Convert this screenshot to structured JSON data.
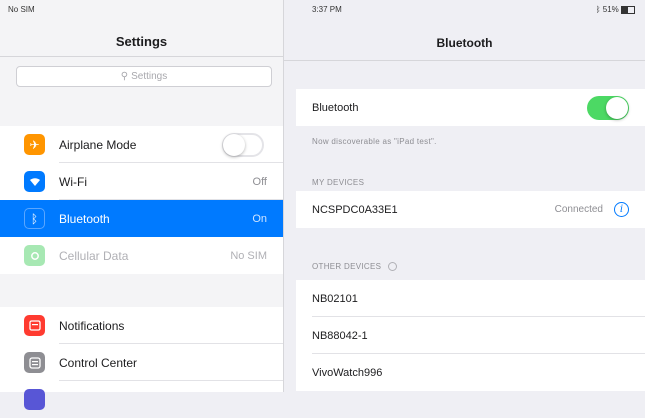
{
  "left": {
    "status_text": "No SIM",
    "title": "Settings",
    "search": {
      "placeholder": "Settings"
    },
    "items": [
      {
        "label": "Airplane Mode",
        "value": "",
        "toggle": "off",
        "icon": "airplane-icon",
        "color": "#ff9500"
      },
      {
        "label": "Wi-Fi",
        "value": "Off",
        "icon": "wifi-icon",
        "color": "#007aff"
      },
      {
        "label": "Bluetooth",
        "value": "On",
        "icon": "bluetooth-icon",
        "color": "#007aff",
        "selected": true
      },
      {
        "label": "Cellular Data",
        "value": "No SIM",
        "icon": "cellular-icon",
        "color": "#4cd964",
        "disabled": true
      },
      {
        "label": "Notifications",
        "icon": "notifications-icon",
        "color": "#ff3b30"
      },
      {
        "label": "Control Center",
        "icon": "control-center-icon",
        "color": "#8e8e93"
      }
    ]
  },
  "right": {
    "time": "3:37 PM",
    "battery": "51%",
    "title": "Bluetooth",
    "bluetooth_label": "Bluetooth",
    "bluetooth_on": true,
    "discoverable_note": "Now discoverable as \"iPad test\".",
    "my_devices_header": "MY DEVICES",
    "my_devices": [
      {
        "name": "NCSPDC0A33E1",
        "status": "Connected"
      }
    ],
    "other_devices_header": "OTHER DEVICES",
    "other_devices": [
      {
        "name": "NB02101"
      },
      {
        "name": "NB88042-1"
      },
      {
        "name": "VivoWatch996"
      }
    ]
  },
  "colors": {
    "accent": "#007aff",
    "toggle_on": "#4cd964",
    "selection": "#007aff"
  }
}
